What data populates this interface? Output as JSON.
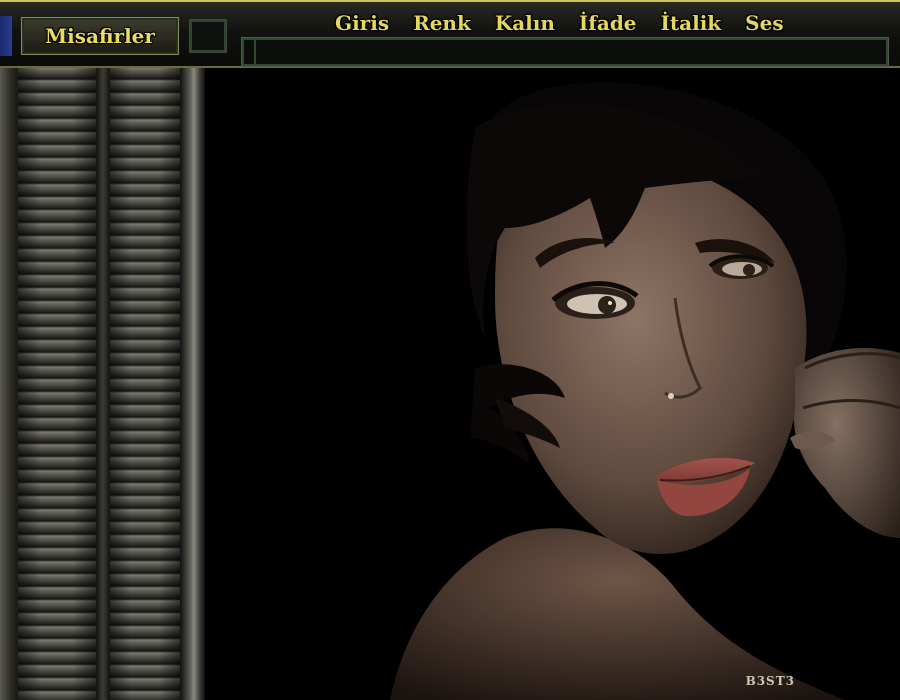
{
  "header": {
    "guests_label": "Misafirler",
    "toolbar": [
      "Giris",
      "Renk",
      "Kalın",
      "İfade",
      "İtalik",
      "Ses"
    ],
    "message_value": ""
  },
  "watermark": "B3ST3",
  "colors": {
    "accent_gold": "#e6d85a",
    "frame_green": "#2f4a2c",
    "background": "#000000"
  }
}
